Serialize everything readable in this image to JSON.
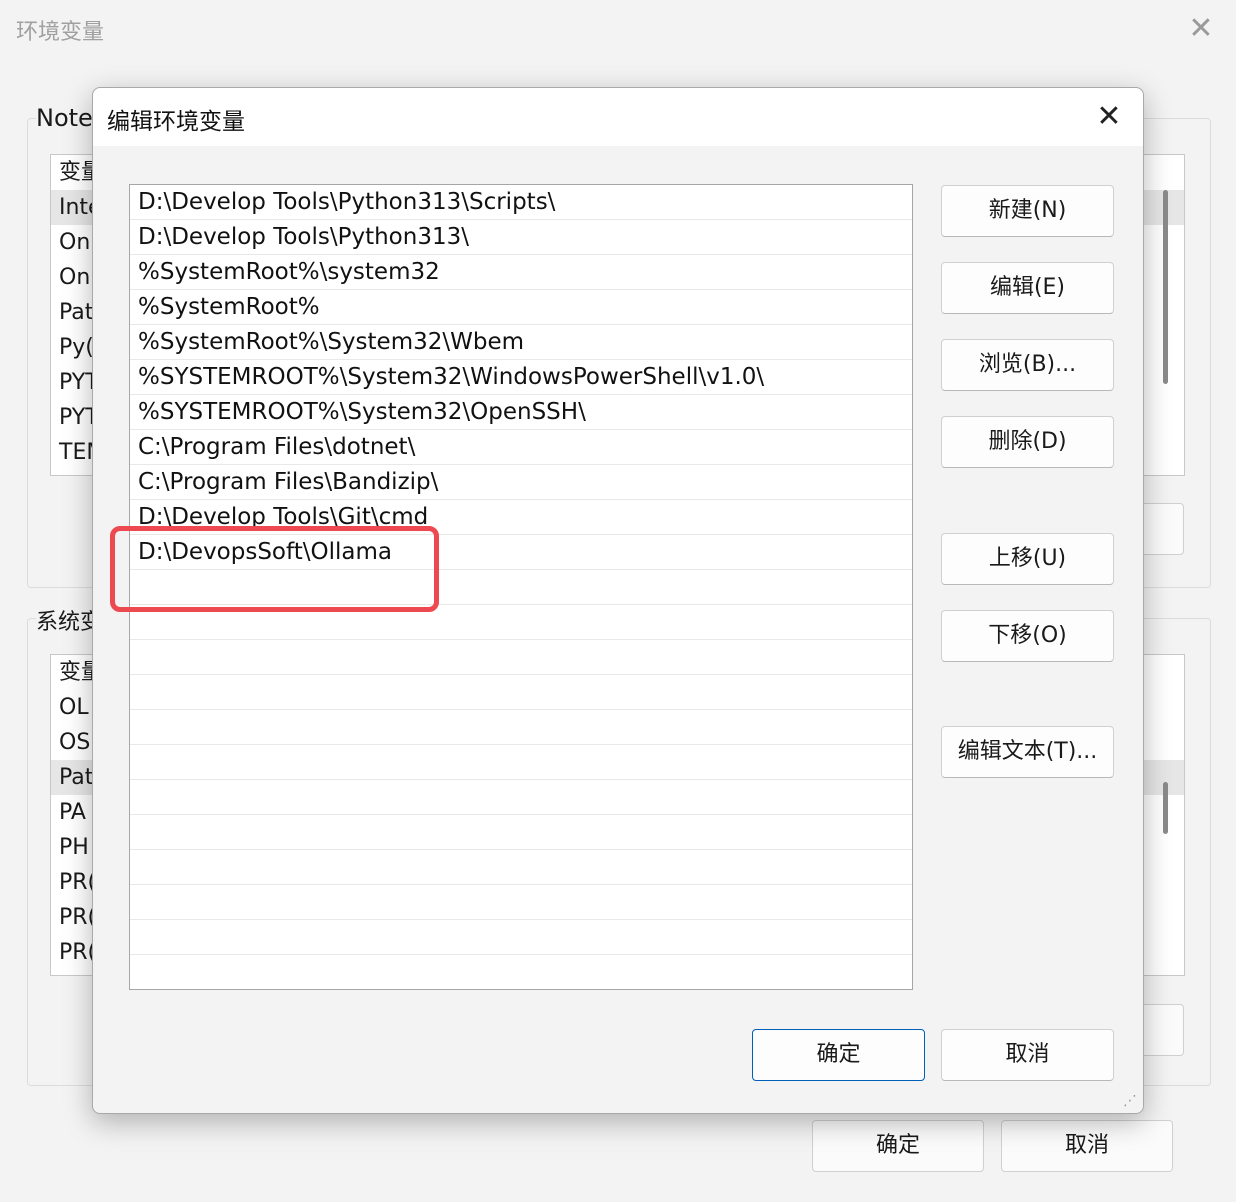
{
  "background_window": {
    "title": "环境变量",
    "user_group_label": "Note",
    "user_list": [
      "变量",
      "Inte",
      "On",
      "On",
      "Pat",
      "Py(",
      "PYT",
      "PYT",
      "TEM"
    ],
    "system_group_label": "系统变",
    "system_list": [
      "变量",
      "OL",
      "OS",
      "Pat",
      "PA",
      "PH",
      "PR(",
      "PR(",
      "PR("
    ],
    "ok_label": "确定",
    "cancel_label": "取消"
  },
  "dialog": {
    "title": "编辑环境变量",
    "close_glyph": "✕",
    "paths": [
      "D:\\Develop Tools\\Python313\\Scripts\\",
      "D:\\Develop Tools\\Python313\\",
      "%SystemRoot%\\system32",
      "%SystemRoot%",
      "%SystemRoot%\\System32\\Wbem",
      "%SYSTEMROOT%\\System32\\WindowsPowerShell\\v1.0\\",
      "%SYSTEMROOT%\\System32\\OpenSSH\\",
      "C:\\Program Files\\dotnet\\",
      "C:\\Program Files\\Bandizip\\",
      "D:\\Develop Tools\\Git\\cmd",
      "D:\\DevopsSoft\\Ollama",
      "",
      "",
      "",
      "",
      "",
      "",
      "",
      "",
      "",
      "",
      "",
      ""
    ],
    "buttons": {
      "new": "新建(N)",
      "edit": "编辑(E)",
      "browse": "浏览(B)...",
      "delete": "删除(D)",
      "move_up": "上移(U)",
      "move_down": "下移(O)",
      "edit_text": "编辑文本(T)...",
      "ok": "确定",
      "cancel": "取消"
    },
    "highlight_color": "#ec4a50",
    "accent_color": "#005fb8"
  }
}
